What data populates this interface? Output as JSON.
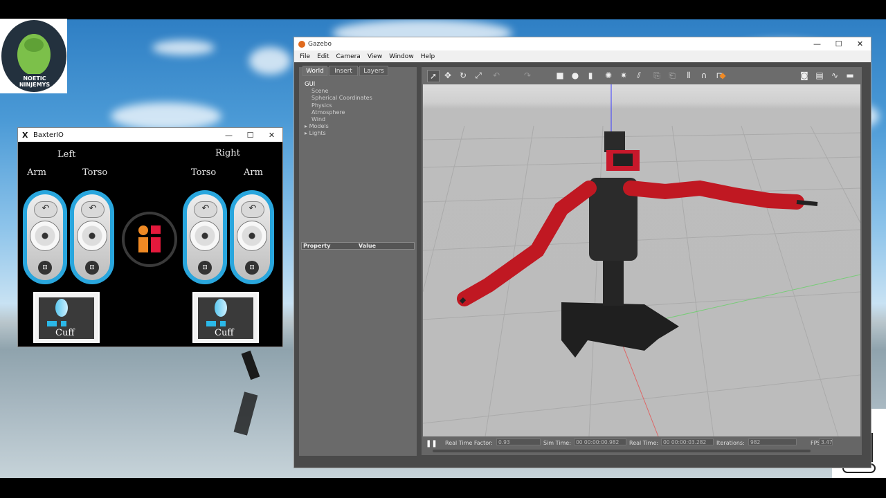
{
  "desktop": {
    "logo_left_text": "NOETIC NINJEMYS"
  },
  "baxter_window": {
    "title": "BaxterIO",
    "minimize": "—",
    "maximize": "☐",
    "close": "✕",
    "left_label": "Left",
    "right_label": "Right",
    "arm_label": "Arm",
    "torso_label": "Torso",
    "cuff_label": "Cuff",
    "back_glyph": "↶",
    "nav_glyph": "⊡",
    "colors": {
      "accent": "#29a6dd",
      "orange": "#f08a24",
      "red": "#e4193c"
    }
  },
  "gazebo_window": {
    "title": "Gazebo",
    "minimize": "—",
    "maximize": "☐",
    "close": "✕",
    "menu": [
      "File",
      "Edit",
      "Camera",
      "View",
      "Window",
      "Help"
    ],
    "tabs": [
      "World",
      "Insert",
      "Layers"
    ],
    "tree": {
      "root": "GUI",
      "items": [
        "Scene",
        "Spherical Coordinates",
        "Physics",
        "Atmosphere",
        "Wind"
      ],
      "expandable": [
        "Models",
        "Lights"
      ]
    },
    "property_header": [
      "Property",
      "Value"
    ],
    "toolbar_icons": [
      "select-arrow-icon",
      "translate-icon",
      "rotate-icon",
      "scale-icon",
      "undo-icon",
      "redo-icon",
      "box-icon",
      "sphere-icon",
      "cylinder-icon",
      "point-light-icon",
      "spot-light-icon",
      "directional-light-icon",
      "copy-icon",
      "paste-icon",
      "align-icon",
      "snap-icon",
      "joint-icon",
      "model-color-icon",
      "screenshot-icon",
      "log-icon",
      "plot-icon",
      "video-icon"
    ],
    "status": {
      "pause": "❚❚",
      "real_time_factor_label": "Real Time Factor:",
      "real_time_factor_value": "0.93",
      "sim_time_label": "Sim Time:",
      "sim_time_value": "00 00:00:00.982",
      "real_time_label": "Real Time:",
      "real_time_value": "00 00:00:03.282",
      "iterations_label": "Iterations:",
      "iterations_value": "982",
      "fps_label": "FPS:",
      "fps_value": "3.47"
    }
  }
}
